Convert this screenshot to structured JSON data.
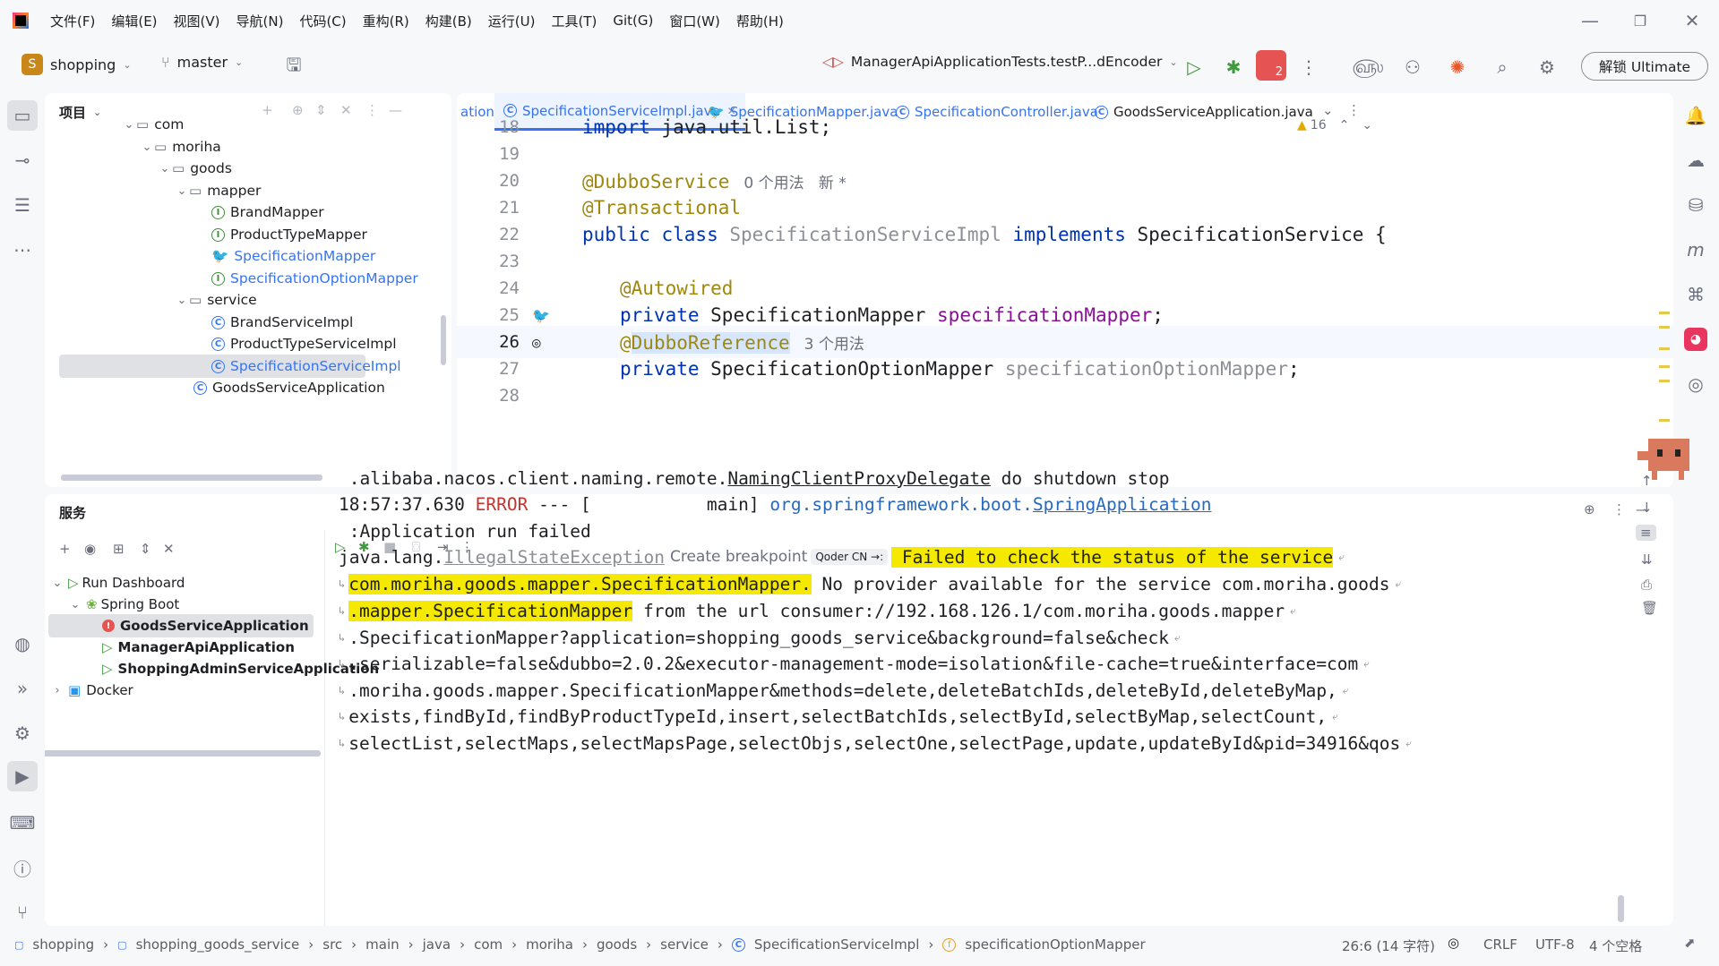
{
  "menu": [
    "文件(F)",
    "编辑(E)",
    "视图(V)",
    "导航(N)",
    "代码(C)",
    "重构(R)",
    "构建(B)",
    "运行(U)",
    "工具(T)",
    "Git(G)",
    "窗口(W)",
    "帮助(H)"
  ],
  "toolbar": {
    "project_initial": "S",
    "project": "shopping",
    "branch": "master",
    "run_config": "ManagerApiApplicationTests.testP...dEncoder",
    "badge_count": "2",
    "unlock": "解锁 Ultimate"
  },
  "project_panel": {
    "title": "项目",
    "tree": [
      {
        "label": "com",
        "kind": "folder"
      },
      {
        "label": "moriha",
        "kind": "folder"
      },
      {
        "label": "goods",
        "kind": "folder"
      },
      {
        "label": "mapper",
        "kind": "folder"
      },
      {
        "label": "BrandMapper",
        "kind": "interface"
      },
      {
        "label": "ProductTypeMapper",
        "kind": "interface"
      },
      {
        "label": "SpecificationMapper",
        "kind": "mybatis"
      },
      {
        "label": "SpecificationOptionMapper",
        "kind": "interface"
      },
      {
        "label": "service",
        "kind": "folder"
      },
      {
        "label": "BrandServiceImpl",
        "kind": "class"
      },
      {
        "label": "ProductTypeServiceImpl",
        "kind": "class"
      },
      {
        "label": "SpecificationServiceImpl",
        "kind": "class"
      },
      {
        "label": "GoodsServiceApplication",
        "kind": "app"
      }
    ]
  },
  "editor": {
    "tabs": [
      {
        "label": "ationMapper.xml"
      },
      {
        "label": "SpecificationServiceImpl.java"
      },
      {
        "label": "SpecificationMapper.java"
      },
      {
        "label": "SpecificationController.java"
      },
      {
        "label": "GoodsServiceApplication.java"
      }
    ],
    "warnings": "16",
    "lines": [
      {
        "n": "18"
      },
      {
        "n": "19"
      },
      {
        "n": "20"
      },
      {
        "n": "21"
      },
      {
        "n": "22"
      },
      {
        "n": "23"
      },
      {
        "n": "24"
      },
      {
        "n": "25"
      },
      {
        "n": "26"
      },
      {
        "n": "27"
      },
      {
        "n": "28"
      }
    ],
    "code": {
      "l18_kw": "import",
      "l18_rest": " java.util.List;",
      "l20_ann": "@DubboService",
      "l20_hint": "0 个用法   新 *",
      "l21_ann": "@Transactional",
      "l22_kw1": "public class",
      "l22_name": " SpecificationServiceImpl ",
      "l22_kw2": "implements",
      "l22_rest": " SpecificationService {",
      "l24_ann": "@Autowired",
      "l25_kw": "private",
      "l25_type": " SpecificationMapper ",
      "l25_field": "specificationMapper",
      "l25_end": ";",
      "l26_at": "@",
      "l26_ann": "DubboReference",
      "l26_hint": "3 个用法",
      "l27_kw": "private",
      "l27_type": " SpecificationOptionMapper ",
      "l27_field": "specificationOptionMapper",
      "l27_end": ";"
    }
  },
  "services": {
    "title": "服务",
    "tree": [
      {
        "label": "Run Dashboard"
      },
      {
        "label": "Spring Boot"
      },
      {
        "label": "GoodsServiceApplication"
      },
      {
        "label": "ManagerApiApplication"
      },
      {
        "label": "ShoppingAdminServiceApplication"
      },
      {
        "label": "Docker"
      }
    ],
    "log": {
      "l1": " .alibaba.nacos.client.naming.remote.",
      "l1_u": "NamingClientProxyDelegate",
      "l1_end": " do shutdown stop",
      "l2_time": "18:57:37.630 ",
      "l2_err": "ERROR",
      "l2_mid": " --- [           main] ",
      "l2_pkg": "org.springframework.boot.",
      "l2_cls": "SpringApplication",
      "l3": " :Application run failed",
      "l4_pre": "java.lang.",
      "l4_exc": "IllegalStateException",
      "l4_bp": "Create breakpoint",
      "l4_qoder": "Qoder CN →:",
      "l4_hl": " Failed to check the status of the service",
      "l5_hl": "com.moriha.goods.mapper.SpecificationMapper.",
      "l5_rest": " No provider available for the service com.moriha.goods",
      "l6_hl": ".mapper.SpecificationMapper",
      "l6_rest": " from the url consumer://192.168.126.1/com.moriha.goods.mapper",
      "l7": ".SpecificationMapper?application=shopping_goods_service&background=false&check",
      "l8": ".serializable=false&dubbo=2.0.2&executor-management-mode=isolation&file-cache=true&interface=com",
      "l9": ".moriha.goods.mapper.SpecificationMapper&methods=delete,deleteBatchIds,deleteById,deleteByMap,",
      "l10": "exists,findById,findByProductTypeId,insert,selectBatchIds,selectById,selectByMap,selectCount,",
      "l11": "selectList,selectMaps,selectMapsPage,selectObjs,selectOne,selectPage,update,updateById&pid=34916&qos"
    }
  },
  "statusbar": {
    "crumbs": [
      "shopping",
      "shopping_goods_service",
      "src",
      "main",
      "java",
      "com",
      "moriha",
      "goods",
      "service",
      "SpecificationServiceImpl",
      "specificationOptionMapper"
    ],
    "position": "26:6 (14 字符)",
    "line_sep": "CRLF",
    "encoding": "UTF-8",
    "indent": "4 个空格"
  },
  "colors": {
    "accent": "#3574f0",
    "error": "#e55353",
    "highlight": "#f5e900",
    "keyword": "#0033b3",
    "annotation": "#9e880d",
    "field": "#871094"
  }
}
